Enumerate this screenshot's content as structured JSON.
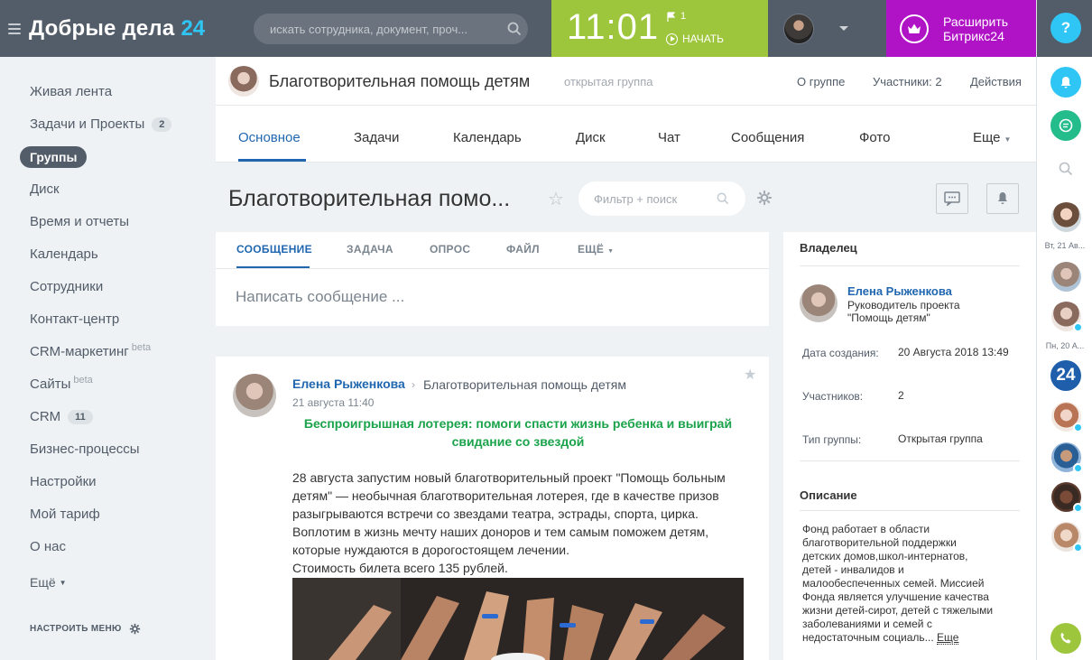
{
  "header": {
    "logo": "Добрые дела",
    "logo_num": "24",
    "search_placeholder": "искать сотрудника, документ, проч...",
    "time": "11:01",
    "flag_count": "1",
    "start_label": "НАЧАТЬ",
    "extend_label_1": "Расширить",
    "extend_label_2": "Битрикс24"
  },
  "sidebar": {
    "items": [
      {
        "label": "Живая лента"
      },
      {
        "label": "Задачи и Проекты",
        "count": "2"
      },
      {
        "label": "Группы"
      },
      {
        "label": "Диск"
      },
      {
        "label": "Время и отчеты"
      },
      {
        "label": "Календарь"
      },
      {
        "label": "Сотрудники"
      },
      {
        "label": "Контакт-центр"
      },
      {
        "label": "CRM-маркетинг",
        "beta": "beta"
      },
      {
        "label": "Сайты",
        "beta": "beta"
      },
      {
        "label": "CRM",
        "count": "11"
      },
      {
        "label": "Бизнес-процессы"
      },
      {
        "label": "Настройки"
      },
      {
        "label": "Мой тариф"
      },
      {
        "label": "О нас"
      },
      {
        "label": "Ещё"
      }
    ],
    "configure": "НАСТРОИТЬ МЕНЮ"
  },
  "group": {
    "title": "Благотворительная помощь детям",
    "type": "открытая группа",
    "about": "О группе",
    "members": "Участники: 2",
    "actions": "Действия"
  },
  "tabs": [
    "Основное",
    "Задачи",
    "Календарь",
    "Диск",
    "Чат",
    "Сообщения",
    "Фото",
    "Еще"
  ],
  "page": {
    "title": "Благотворительная помо...",
    "filter_placeholder": "Фильтр + поиск"
  },
  "composer": {
    "tabs": [
      "СООБЩЕНИЕ",
      "ЗАДАЧА",
      "ОПРОС",
      "ФАЙЛ",
      "ЕЩЁ"
    ],
    "placeholder": "Написать сообщение ..."
  },
  "post": {
    "author": "Елена Рыженкова",
    "group": "Благотворительная помощь детям",
    "date": "21 августа 11:40",
    "headline": "Беспроигрышная лотерея: помоги спасти жизнь ребенка и выиграй свидание со звездой",
    "body_lines": [
      "28 августа запустим новый благотворительный проект \"Помощь больным",
      "детям\" — необычная благотворительная лотерея, где в качестве призов",
      "разыгрываются встречи со звездами театра, эстрады, спорта, цирка.",
      "Воплотим в жизнь мечту  наших доноров и тем самым поможем детям,",
      "которые нуждаются в дорогостоящем лечении.",
      "Стоимость билета всего 135 рублей."
    ]
  },
  "info": {
    "owner_h": "Владелец",
    "owner_name": "Елена Рыженкова",
    "owner_role_1": "Руководитель проекта",
    "owner_role_2": "\"Помощь детям\"",
    "created_lbl": "Дата создания:",
    "created_val": "20 Августа 2018 13:49",
    "members_lbl": "Участников:",
    "members_val": "2",
    "type_lbl": "Тип группы:",
    "type_val": "Открытая группа",
    "desc_h": "Описание",
    "desc_lines": [
      "Фонд работает в области",
      "благотворительной поддержки",
      "детских домов,школ-интернатов,",
      "детей - инвалидов и",
      "малообеспеченных семей. Миссией",
      "Фонда является улучшение качества",
      "жизни детей-сирот, детей с тяжелыми",
      "заболеваниями и семей с",
      "недостаточным социаль..."
    ],
    "desc_more": "Еще"
  },
  "rightbar": {
    "date_1": "Вт, 21 Ав...",
    "date_2": "Пн, 20 А...",
    "b24": "24"
  },
  "colors": {
    "topbar": "#535c69",
    "clock": "#9dc63c",
    "extend": "#b012c6",
    "accent": "#2fc6f6",
    "link": "#2067b0",
    "post_headline": "#1aa34a"
  }
}
